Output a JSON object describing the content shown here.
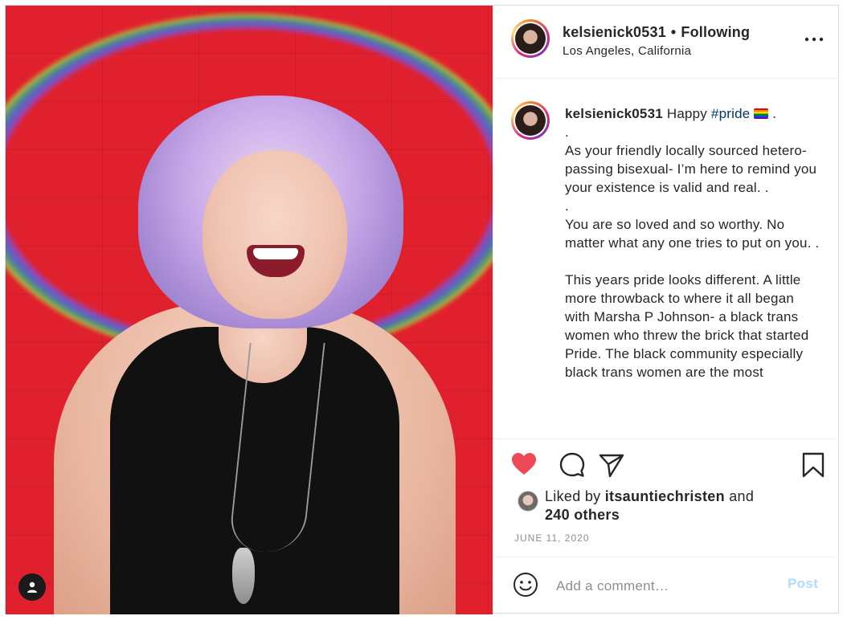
{
  "header": {
    "username": "kelsienick0531",
    "separator": "•",
    "follow_status": "Following",
    "location": "Los Angeles, California"
  },
  "caption": {
    "username": "kelsienick0531",
    "greeting": "Happy ",
    "hashtag": "#pride",
    "after_flag": " .",
    "body": ".\nAs your friendly locally sourced hetero-passing bisexual- I’m here to remind you your existence is valid and real. .\n.\nYou are so loved and so worthy. No matter what any one tries to put on you. .\n\nThis years pride looks different. A little more throwback to where it all began with Marsha P Johnson- a black trans women who threw the brick that started Pride. The black community especially black trans women are the most"
  },
  "likes": {
    "prefix": "Liked by ",
    "liker": "itsauntiechristen",
    "and": " and",
    "others": "240 others"
  },
  "date": "JUNE 11, 2020",
  "comment": {
    "placeholder": "Add a comment…",
    "post_label": "Post"
  },
  "icons": {
    "like": "heart-icon",
    "comment": "comment-icon",
    "share": "share-icon",
    "save": "bookmark-icon",
    "more": "more-icon",
    "emoji": "emoji-icon",
    "user_tag": "user-icon"
  },
  "colors": {
    "liked_heart": "#ed4956",
    "link_blue": "#00376b",
    "post_button_disabled": "#b3dbff"
  }
}
